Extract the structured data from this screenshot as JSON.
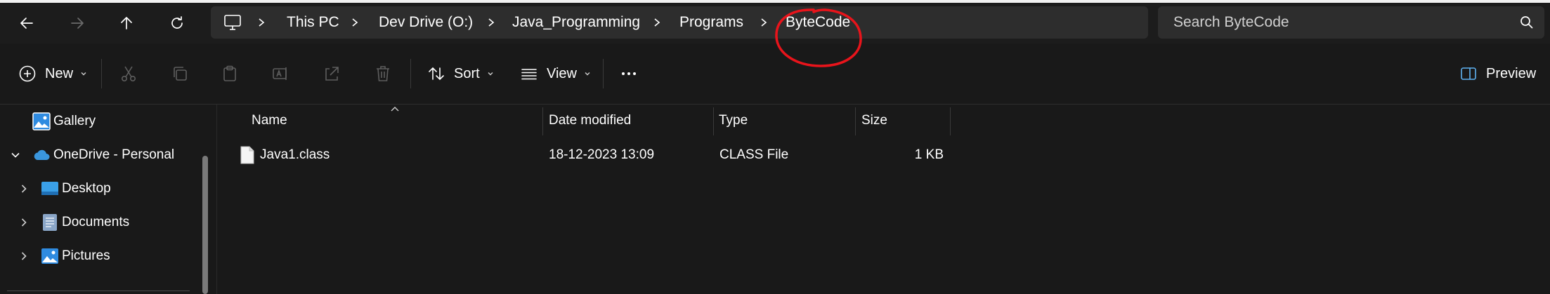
{
  "nav": {
    "back_icon": "arrow-left-icon",
    "forward_icon": "arrow-right-icon",
    "up_icon": "arrow-up-icon",
    "refresh_icon": "refresh-icon"
  },
  "breadcrumb": {
    "root_icon": "monitor-icon",
    "items": [
      "This PC",
      "Dev Drive (O:)",
      "Java_Programming",
      "Programs",
      "ByteCode"
    ]
  },
  "search": {
    "placeholder": "Search ByteCode"
  },
  "toolbar": {
    "new_label": "New",
    "sort_label": "Sort",
    "view_label": "View",
    "preview_label": "Preview"
  },
  "sidebar": {
    "items": [
      {
        "label": "Gallery",
        "icon": "gallery-icon",
        "expand": "none"
      },
      {
        "label": "OneDrive - Personal",
        "icon": "cloud-icon",
        "expand": "expanded"
      },
      {
        "label": "Desktop",
        "icon": "desktop-folder-icon",
        "expand": "collapsed"
      },
      {
        "label": "Documents",
        "icon": "documents-folder-icon",
        "expand": "collapsed"
      },
      {
        "label": "Pictures",
        "icon": "pictures-folder-icon",
        "expand": "collapsed"
      }
    ]
  },
  "columns": {
    "name": "Name",
    "date": "Date modified",
    "type": "Type",
    "size": "Size"
  },
  "files": [
    {
      "name": "Java1.class",
      "date": "18-12-2023 13:09",
      "type": "CLASS File",
      "size": "1 KB"
    }
  ],
  "colors": {
    "background": "#191919",
    "address_bar": "#2d2d2d",
    "annotation": "#e8141b",
    "onedrive": "#3a96dd"
  }
}
